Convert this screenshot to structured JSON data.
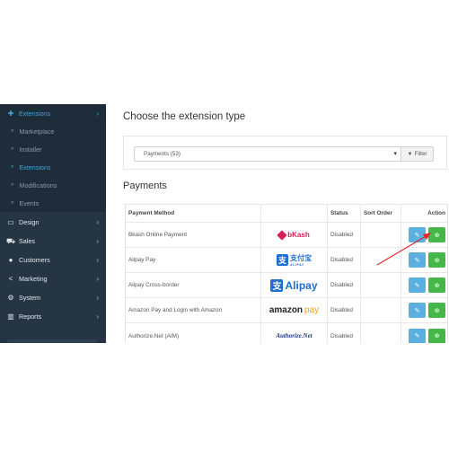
{
  "sidebar": {
    "extensions": "Extensions",
    "sub": [
      "Marketplace",
      "Installer",
      "Extensions",
      "Modifications",
      "Events"
    ],
    "design": "Design",
    "sales": "Sales",
    "customers": "Customers",
    "marketing": "Marketing",
    "system": "System",
    "reports": "Reports"
  },
  "main": {
    "title": "Choose the extension type",
    "select_value": "Payments (53)",
    "filter_label": "Filter",
    "section_title": "Payments"
  },
  "table": {
    "headers": [
      "Payment Method",
      "",
      "Status",
      "Sort Order",
      "Action"
    ],
    "rows": [
      {
        "name": "Bkash Online Payment",
        "logo": "bKash",
        "status": "Disabled",
        "sort": ""
      },
      {
        "name": "Alipay Pay",
        "logo": "支付宝",
        "logo_sub": "ALIPAY",
        "status": "Disabled",
        "sort": ""
      },
      {
        "name": "Alipay Cross-border",
        "logo": "Alipay",
        "status": "Disabled",
        "sort": ""
      },
      {
        "name": "Amazon Pay and Login with Amazon",
        "logo": "amazon",
        "logo_pay": "pay",
        "status": "Disabled",
        "sort": ""
      },
      {
        "name": "Authorize.Net (AIM)",
        "logo": "Authorize.Net",
        "status": "Disabled",
        "sort": ""
      }
    ]
  },
  "icons": {
    "edit": "pencil-icon",
    "install": "plus-circle-icon"
  },
  "colors": {
    "sidebar_bg": "#253544",
    "active": "#43a3d9",
    "edit_btn": "#5bb0e0",
    "install_btn": "#46b84a",
    "arrow": "#e0282e"
  }
}
